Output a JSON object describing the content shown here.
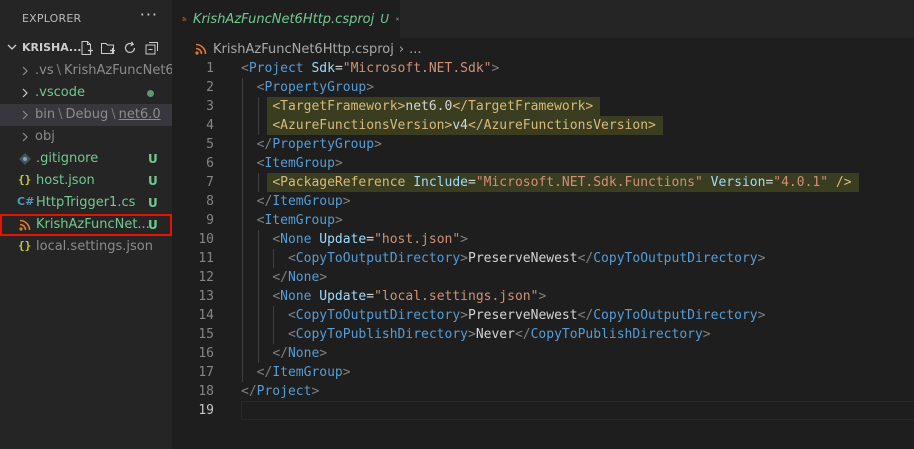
{
  "sidebar": {
    "title": "EXPLORER",
    "more_label": "···",
    "folder": {
      "name": "KRISHA..."
    },
    "items": [
      {
        "type": "folder",
        "path": [
          ".vs",
          "KrishAzFuncNet6..."
        ],
        "status": "",
        "dim": true
      },
      {
        "type": "folder",
        "path": [
          ".vscode"
        ],
        "status": "dot",
        "dim": false
      },
      {
        "type": "folder",
        "path": [
          "bin",
          "Debug",
          "net6.0"
        ],
        "status": "",
        "dim": true,
        "selected": true
      },
      {
        "type": "folder",
        "path": [
          "obj"
        ],
        "status": "",
        "dim": true
      },
      {
        "type": "file",
        "name": ".gitignore",
        "status": "U",
        "icon": "gitignore-icon"
      },
      {
        "type": "file",
        "name": "host.json",
        "status": "U",
        "icon": "json-icon"
      },
      {
        "type": "file",
        "name": "HttpTrigger1.cs",
        "status": "U",
        "icon": "csharp-icon"
      },
      {
        "type": "file",
        "name": "KrishAzFuncNet...",
        "status": "U",
        "icon": "rss-icon",
        "highlighted": true
      },
      {
        "type": "file",
        "name": "local.settings.json",
        "status": "",
        "icon": "json-icon"
      }
    ]
  },
  "editor": {
    "tab": {
      "title": "KrishAzFuncNet6Http.csproj",
      "badge": "U"
    },
    "breadcrumb": {
      "file": "KrishAzFuncNet6Http.csproj",
      "more": "..."
    },
    "current_line": 19,
    "lines": [
      [
        [
          "br",
          "<"
        ],
        [
          "tag",
          "Project"
        ],
        [
          "t",
          " "
        ],
        [
          "attr",
          "Sdk"
        ],
        [
          "t",
          "="
        ],
        [
          "val",
          "\"Microsoft.NET.Sdk\""
        ],
        [
          "br",
          ">"
        ]
      ],
      [
        [
          "t",
          "  "
        ],
        [
          "br",
          "<"
        ],
        [
          "tag",
          "PropertyGroup"
        ],
        [
          "br",
          ">"
        ]
      ],
      [
        [
          "t",
          "    "
        ],
        [
          "br",
          "<"
        ],
        [
          "tag",
          "TargetFramework"
        ],
        [
          "br",
          ">"
        ],
        [
          "text",
          "net6.0"
        ],
        [
          "br",
          "</"
        ],
        [
          "tag",
          "TargetFramework"
        ],
        [
          "br",
          ">"
        ]
      ],
      [
        [
          "t",
          "    "
        ],
        [
          "br",
          "<"
        ],
        [
          "tag",
          "AzureFunctionsVersion"
        ],
        [
          "br",
          ">"
        ],
        [
          "text",
          "v4"
        ],
        [
          "br",
          "</"
        ],
        [
          "tag",
          "AzureFunctionsVersion"
        ],
        [
          "br",
          ">"
        ]
      ],
      [
        [
          "t",
          "  "
        ],
        [
          "br",
          "</"
        ],
        [
          "tag",
          "PropertyGroup"
        ],
        [
          "br",
          ">"
        ]
      ],
      [
        [
          "t",
          "  "
        ],
        [
          "br",
          "<"
        ],
        [
          "tag",
          "ItemGroup"
        ],
        [
          "br",
          ">"
        ]
      ],
      [
        [
          "t",
          "    "
        ],
        [
          "br",
          "<"
        ],
        [
          "tag",
          "PackageReference"
        ],
        [
          "t",
          " "
        ],
        [
          "attr",
          "Include"
        ],
        [
          "t",
          "="
        ],
        [
          "val",
          "\"Microsoft.NET.Sdk.Functions\""
        ],
        [
          "t",
          " "
        ],
        [
          "attr",
          "Version"
        ],
        [
          "t",
          "="
        ],
        [
          "val",
          "\"4.0.1\""
        ],
        [
          "t",
          " "
        ],
        [
          "br",
          "/>"
        ]
      ],
      [
        [
          "t",
          "  "
        ],
        [
          "br",
          "</"
        ],
        [
          "tag",
          "ItemGroup"
        ],
        [
          "br",
          ">"
        ]
      ],
      [
        [
          "t",
          "  "
        ],
        [
          "br",
          "<"
        ],
        [
          "tag",
          "ItemGroup"
        ],
        [
          "br",
          ">"
        ]
      ],
      [
        [
          "t",
          "    "
        ],
        [
          "br",
          "<"
        ],
        [
          "tag",
          "None"
        ],
        [
          "t",
          " "
        ],
        [
          "attr",
          "Update"
        ],
        [
          "t",
          "="
        ],
        [
          "val",
          "\"host.json\""
        ],
        [
          "br",
          ">"
        ]
      ],
      [
        [
          "t",
          "      "
        ],
        [
          "br",
          "<"
        ],
        [
          "tag",
          "CopyToOutputDirectory"
        ],
        [
          "br",
          ">"
        ],
        [
          "text",
          "PreserveNewest"
        ],
        [
          "br",
          "</"
        ],
        [
          "tag",
          "CopyToOutputDirectory"
        ],
        [
          "br",
          ">"
        ]
      ],
      [
        [
          "t",
          "    "
        ],
        [
          "br",
          "</"
        ],
        [
          "tag",
          "None"
        ],
        [
          "br",
          ">"
        ]
      ],
      [
        [
          "t",
          "    "
        ],
        [
          "br",
          "<"
        ],
        [
          "tag",
          "None"
        ],
        [
          "t",
          " "
        ],
        [
          "attr",
          "Update"
        ],
        [
          "t",
          "="
        ],
        [
          "val",
          "\"local.settings.json\""
        ],
        [
          "br",
          ">"
        ]
      ],
      [
        [
          "t",
          "      "
        ],
        [
          "br",
          "<"
        ],
        [
          "tag",
          "CopyToOutputDirectory"
        ],
        [
          "br",
          ">"
        ],
        [
          "text",
          "PreserveNewest"
        ],
        [
          "br",
          "</"
        ],
        [
          "tag",
          "CopyToOutputDirectory"
        ],
        [
          "br",
          ">"
        ]
      ],
      [
        [
          "t",
          "      "
        ],
        [
          "br",
          "<"
        ],
        [
          "tag",
          "CopyToPublishDirectory"
        ],
        [
          "br",
          ">"
        ],
        [
          "text",
          "Never"
        ],
        [
          "br",
          "</"
        ],
        [
          "tag",
          "CopyToPublishDirectory"
        ],
        [
          "br",
          ">"
        ]
      ],
      [
        [
          "t",
          "    "
        ],
        [
          "br",
          "</"
        ],
        [
          "tag",
          "None"
        ],
        [
          "br",
          ">"
        ]
      ],
      [
        [
          "t",
          "  "
        ],
        [
          "br",
          "</"
        ],
        [
          "tag",
          "ItemGroup"
        ],
        [
          "br",
          ">"
        ]
      ],
      [
        [
          "br",
          "</"
        ],
        [
          "tag",
          "Project"
        ],
        [
          "br",
          ">"
        ]
      ],
      []
    ],
    "highlighted_lines": [
      3,
      4,
      7
    ]
  },
  "colors": {
    "tag": "#569cd6",
    "attr": "#9cdcfe",
    "value": "#ce9178",
    "git_untracked": "#73c991",
    "highlight_border": "#e51400"
  }
}
